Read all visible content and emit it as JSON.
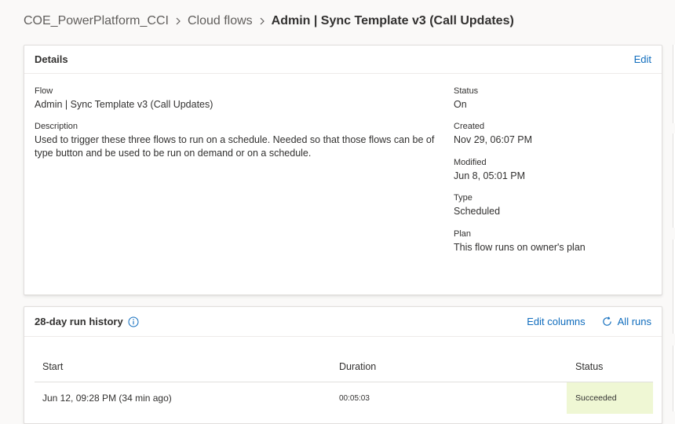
{
  "breadcrumb": {
    "env": "COE_PowerPlatform_CCI",
    "section": "Cloud flows",
    "current": "Admin | Sync Template v3 (Call Updates)"
  },
  "details": {
    "title": "Details",
    "edit_label": "Edit",
    "flow_label": "Flow",
    "flow_value": "Admin | Sync Template v3 (Call Updates)",
    "description_label": "Description",
    "description_value": "Used to trigger these three flows to run on a schedule. Needed so that those flows can be of type button and be used to be run on demand or on a schedule.",
    "status_label": "Status",
    "status_value": "On",
    "created_label": "Created",
    "created_value": "Nov 29, 06:07 PM",
    "modified_label": "Modified",
    "modified_value": "Jun 8, 05:01 PM",
    "type_label": "Type",
    "type_value": "Scheduled",
    "plan_label": "Plan",
    "plan_value": "This flow runs on owner's plan"
  },
  "runs": {
    "title": "28-day run history",
    "edit_columns_label": "Edit columns",
    "all_runs_label": "All runs",
    "columns": [
      "Start",
      "Duration",
      "Status"
    ],
    "rows": [
      {
        "start": "Jun 12, 09:28 PM (34 min ago)",
        "duration": "00:05:03",
        "status": "Succeeded"
      }
    ]
  },
  "colors": {
    "link": "#0f6cbd",
    "success_bg": "#eff7d4"
  }
}
